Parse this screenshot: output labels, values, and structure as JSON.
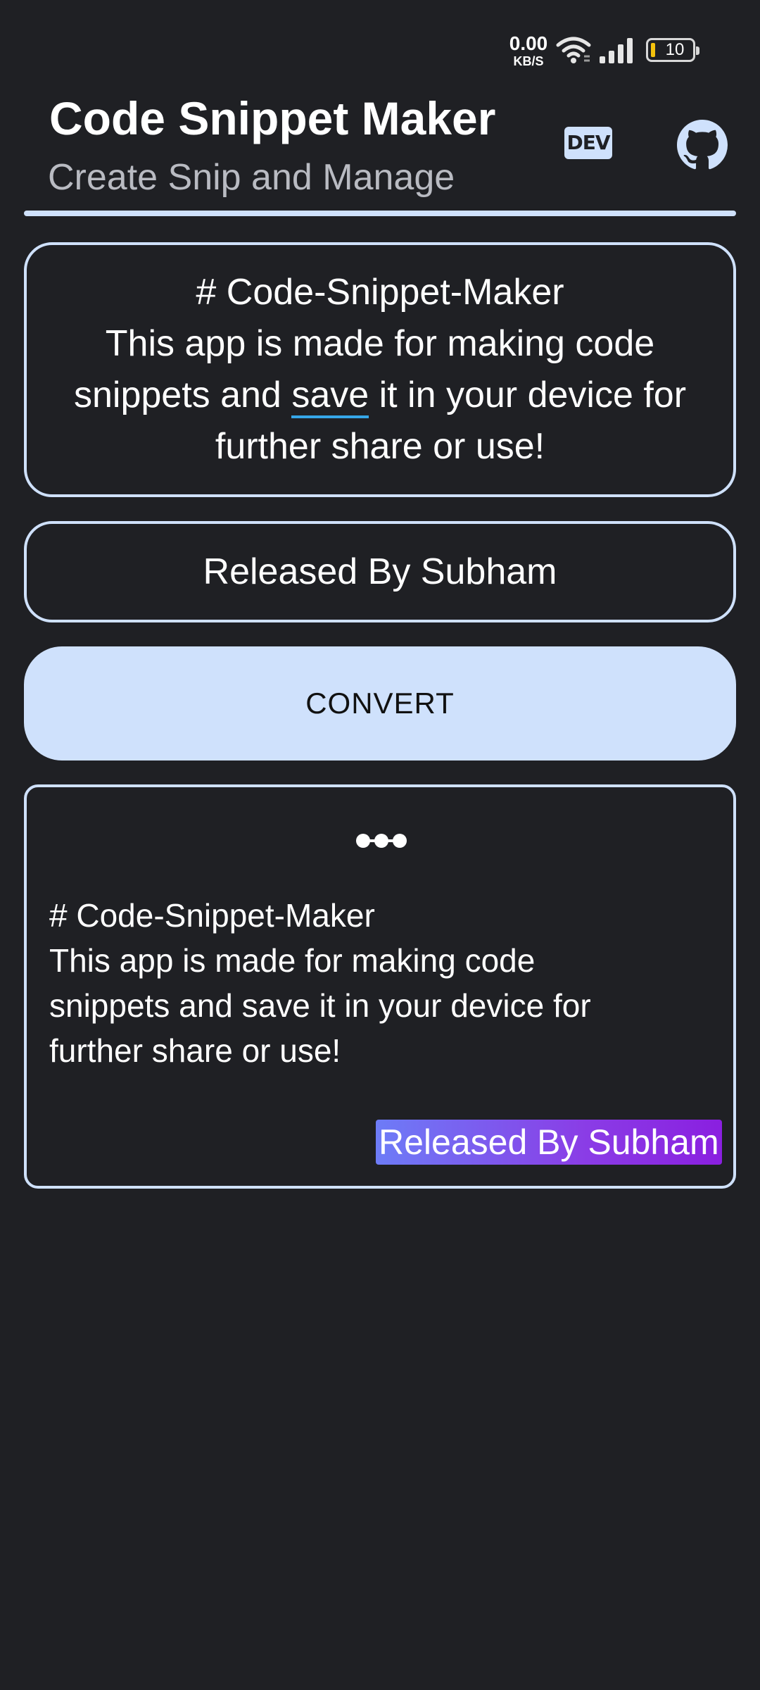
{
  "status_bar": {
    "net_speed_value": "0.00",
    "net_speed_unit": "KB/S",
    "battery_level": "10",
    "icons": [
      "wifi-icon",
      "signal-icon",
      "battery-icon"
    ]
  },
  "app_bar": {
    "title": "Code Snippet Maker",
    "subtitle": "Create Snip and Manage",
    "dev_badge": "DEV",
    "github_icon": "github-icon"
  },
  "markdown_input": {
    "line1": "# Code-Snippet-Maker",
    "line2": "This app is made for making code",
    "line3_before": "snippets and ",
    "line3_underlined": "save",
    "line3_after": " it in your device for",
    "line4": "further share or use!"
  },
  "author_input": {
    "value": "Released By Subham"
  },
  "convert_button": {
    "label": "CONVERT"
  },
  "snippet_preview": {
    "window_icon": "window-dots-icon",
    "text": "# Code-Snippet-Maker\nThis app is made for making code\nsnippets and save it in your device for\nfurther share or use!",
    "author": "Released By Subham"
  },
  "colors": {
    "background": "#1f2024",
    "accent": "#cfe1fc",
    "spell_underline": "#36a6e8",
    "author_gradient_start": "#6d7cf7",
    "author_gradient_end": "#8a1fe0"
  }
}
